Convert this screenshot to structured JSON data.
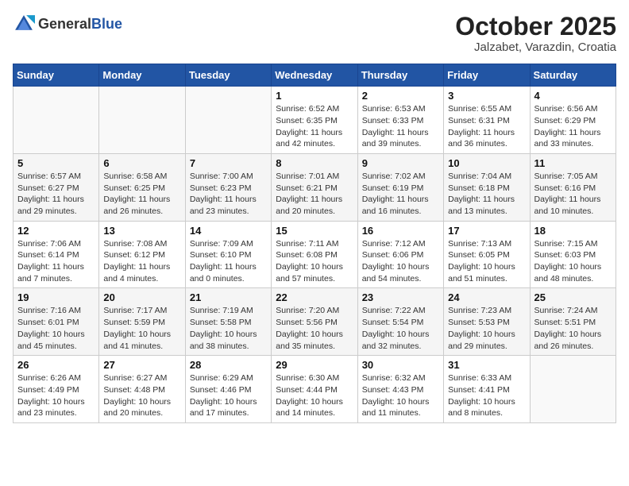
{
  "header": {
    "logo_general": "General",
    "logo_blue": "Blue",
    "month_title": "October 2025",
    "location": "Jalzabet, Varazdin, Croatia"
  },
  "weekdays": [
    "Sunday",
    "Monday",
    "Tuesday",
    "Wednesday",
    "Thursday",
    "Friday",
    "Saturday"
  ],
  "weeks": [
    [
      {
        "day": "",
        "info": ""
      },
      {
        "day": "",
        "info": ""
      },
      {
        "day": "",
        "info": ""
      },
      {
        "day": "1",
        "info": "Sunrise: 6:52 AM\nSunset: 6:35 PM\nDaylight: 11 hours\nand 42 minutes."
      },
      {
        "day": "2",
        "info": "Sunrise: 6:53 AM\nSunset: 6:33 PM\nDaylight: 11 hours\nand 39 minutes."
      },
      {
        "day": "3",
        "info": "Sunrise: 6:55 AM\nSunset: 6:31 PM\nDaylight: 11 hours\nand 36 minutes."
      },
      {
        "day": "4",
        "info": "Sunrise: 6:56 AM\nSunset: 6:29 PM\nDaylight: 11 hours\nand 33 minutes."
      }
    ],
    [
      {
        "day": "5",
        "info": "Sunrise: 6:57 AM\nSunset: 6:27 PM\nDaylight: 11 hours\nand 29 minutes."
      },
      {
        "day": "6",
        "info": "Sunrise: 6:58 AM\nSunset: 6:25 PM\nDaylight: 11 hours\nand 26 minutes."
      },
      {
        "day": "7",
        "info": "Sunrise: 7:00 AM\nSunset: 6:23 PM\nDaylight: 11 hours\nand 23 minutes."
      },
      {
        "day": "8",
        "info": "Sunrise: 7:01 AM\nSunset: 6:21 PM\nDaylight: 11 hours\nand 20 minutes."
      },
      {
        "day": "9",
        "info": "Sunrise: 7:02 AM\nSunset: 6:19 PM\nDaylight: 11 hours\nand 16 minutes."
      },
      {
        "day": "10",
        "info": "Sunrise: 7:04 AM\nSunset: 6:18 PM\nDaylight: 11 hours\nand 13 minutes."
      },
      {
        "day": "11",
        "info": "Sunrise: 7:05 AM\nSunset: 6:16 PM\nDaylight: 11 hours\nand 10 minutes."
      }
    ],
    [
      {
        "day": "12",
        "info": "Sunrise: 7:06 AM\nSunset: 6:14 PM\nDaylight: 11 hours\nand 7 minutes."
      },
      {
        "day": "13",
        "info": "Sunrise: 7:08 AM\nSunset: 6:12 PM\nDaylight: 11 hours\nand 4 minutes."
      },
      {
        "day": "14",
        "info": "Sunrise: 7:09 AM\nSunset: 6:10 PM\nDaylight: 11 hours\nand 0 minutes."
      },
      {
        "day": "15",
        "info": "Sunrise: 7:11 AM\nSunset: 6:08 PM\nDaylight: 10 hours\nand 57 minutes."
      },
      {
        "day": "16",
        "info": "Sunrise: 7:12 AM\nSunset: 6:06 PM\nDaylight: 10 hours\nand 54 minutes."
      },
      {
        "day": "17",
        "info": "Sunrise: 7:13 AM\nSunset: 6:05 PM\nDaylight: 10 hours\nand 51 minutes."
      },
      {
        "day": "18",
        "info": "Sunrise: 7:15 AM\nSunset: 6:03 PM\nDaylight: 10 hours\nand 48 minutes."
      }
    ],
    [
      {
        "day": "19",
        "info": "Sunrise: 7:16 AM\nSunset: 6:01 PM\nDaylight: 10 hours\nand 45 minutes."
      },
      {
        "day": "20",
        "info": "Sunrise: 7:17 AM\nSunset: 5:59 PM\nDaylight: 10 hours\nand 41 minutes."
      },
      {
        "day": "21",
        "info": "Sunrise: 7:19 AM\nSunset: 5:58 PM\nDaylight: 10 hours\nand 38 minutes."
      },
      {
        "day": "22",
        "info": "Sunrise: 7:20 AM\nSunset: 5:56 PM\nDaylight: 10 hours\nand 35 minutes."
      },
      {
        "day": "23",
        "info": "Sunrise: 7:22 AM\nSunset: 5:54 PM\nDaylight: 10 hours\nand 32 minutes."
      },
      {
        "day": "24",
        "info": "Sunrise: 7:23 AM\nSunset: 5:53 PM\nDaylight: 10 hours\nand 29 minutes."
      },
      {
        "day": "25",
        "info": "Sunrise: 7:24 AM\nSunset: 5:51 PM\nDaylight: 10 hours\nand 26 minutes."
      }
    ],
    [
      {
        "day": "26",
        "info": "Sunrise: 6:26 AM\nSunset: 4:49 PM\nDaylight: 10 hours\nand 23 minutes."
      },
      {
        "day": "27",
        "info": "Sunrise: 6:27 AM\nSunset: 4:48 PM\nDaylight: 10 hours\nand 20 minutes."
      },
      {
        "day": "28",
        "info": "Sunrise: 6:29 AM\nSunset: 4:46 PM\nDaylight: 10 hours\nand 17 minutes."
      },
      {
        "day": "29",
        "info": "Sunrise: 6:30 AM\nSunset: 4:44 PM\nDaylight: 10 hours\nand 14 minutes."
      },
      {
        "day": "30",
        "info": "Sunrise: 6:32 AM\nSunset: 4:43 PM\nDaylight: 10 hours\nand 11 minutes."
      },
      {
        "day": "31",
        "info": "Sunrise: 6:33 AM\nSunset: 4:41 PM\nDaylight: 10 hours\nand 8 minutes."
      },
      {
        "day": "",
        "info": ""
      }
    ]
  ]
}
